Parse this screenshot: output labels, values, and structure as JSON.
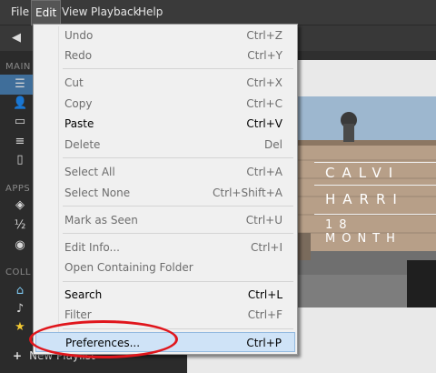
{
  "menubar": {
    "items": [
      "File",
      "Edit",
      "View",
      "Playback",
      "Help"
    ]
  },
  "sidebar": {
    "sections": [
      "MAIN",
      "APPS",
      "COLL"
    ]
  },
  "bottombar": {
    "new_playlist_label": "New Playlist"
  },
  "album": {
    "line1": "CALVI",
    "line2": "HARRI",
    "line3": "18 MONTH"
  },
  "edit_menu": {
    "items": [
      {
        "label": "Undo",
        "shortcut": "Ctrl+Z",
        "enabled": false
      },
      {
        "label": "Redo",
        "shortcut": "Ctrl+Y",
        "enabled": false
      },
      {
        "label": "Cut",
        "shortcut": "Ctrl+X",
        "enabled": false
      },
      {
        "label": "Copy",
        "shortcut": "Ctrl+C",
        "enabled": false
      },
      {
        "label": "Paste",
        "shortcut": "Ctrl+V",
        "enabled": true
      },
      {
        "label": "Delete",
        "shortcut": "Del",
        "enabled": false
      },
      {
        "label": "Select All",
        "shortcut": "Ctrl+A",
        "enabled": false
      },
      {
        "label": "Select None",
        "shortcut": "Ctrl+Shift+A",
        "enabled": false
      },
      {
        "label": "Mark as Seen",
        "shortcut": "Ctrl+U",
        "enabled": false
      },
      {
        "label": "Edit Info...",
        "shortcut": "Ctrl+I",
        "enabled": false
      },
      {
        "label": "Open Containing Folder",
        "shortcut": "",
        "enabled": false
      },
      {
        "label": "Search",
        "shortcut": "Ctrl+L",
        "enabled": true
      },
      {
        "label": "Filter",
        "shortcut": "Ctrl+F",
        "enabled": false
      },
      {
        "label": "Preferences...",
        "shortcut": "Ctrl+P",
        "enabled": true,
        "highlighted": true
      }
    ]
  },
  "colors": {
    "highlight_bg": "#cfe3f7",
    "annotation_red": "#e0161c"
  }
}
